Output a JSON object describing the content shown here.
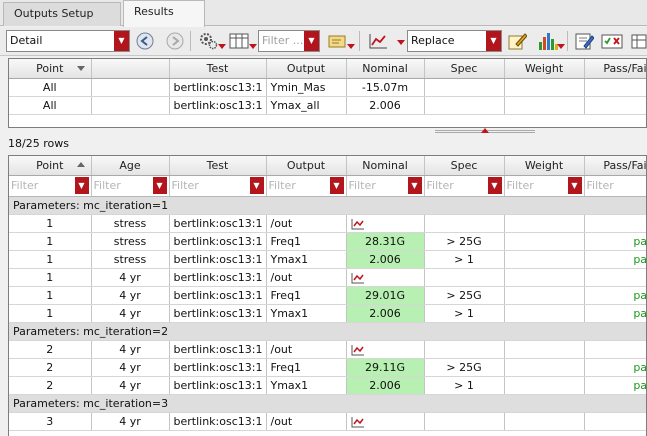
{
  "tabs": [
    {
      "label": "Outputs Setup",
      "active": false
    },
    {
      "label": "Results",
      "active": true
    }
  ],
  "toolbar": {
    "view_select": "Detail",
    "filter_placeholder": "Filter ...",
    "plot_mode": "Replace"
  },
  "colors": {
    "accent_red": "#b3151d",
    "pass_green": "#1d9a1d",
    "nominal_bg": "#b7f0b2"
  },
  "top_table": {
    "columns": [
      "Point",
      "",
      "Test",
      "Output",
      "Nominal",
      "Spec",
      "Weight",
      "Pass/Fail"
    ],
    "rows": [
      {
        "point": "All",
        "test": "bertlink:osc13:1",
        "output": "Ymin_Mas",
        "nominal": "-15.07m"
      },
      {
        "point": "All",
        "test": "bertlink:osc13:1",
        "output": "Ymax_all",
        "nominal": "2.006"
      }
    ]
  },
  "row_count": "18/25 rows",
  "main_table": {
    "columns": [
      "Point",
      "Age",
      "Test",
      "Output",
      "Nominal",
      "Spec",
      "Weight",
      "Pass/Fail"
    ],
    "filter_placeholder": "Filter",
    "groups": [
      {
        "label": "Parameters: mc_iteration=1",
        "rows": [
          {
            "point": "1",
            "age": "stress",
            "test": "bertlink:osc13:1",
            "output": "/out",
            "nominal": "",
            "wave": true,
            "spec": "",
            "pass": ""
          },
          {
            "point": "1",
            "age": "stress",
            "test": "bertlink:osc13:1",
            "output": "Freq1",
            "nominal": "28.31G",
            "wave": false,
            "spec": "> 25G",
            "pass": "pass"
          },
          {
            "point": "1",
            "age": "stress",
            "test": "bertlink:osc13:1",
            "output": "Ymax1",
            "nominal": "2.006",
            "wave": false,
            "spec": "> 1",
            "pass": "pass"
          },
          {
            "point": "1",
            "age": "4 yr",
            "test": "bertlink:osc13:1",
            "output": "/out",
            "nominal": "",
            "wave": true,
            "spec": "",
            "pass": ""
          },
          {
            "point": "1",
            "age": "4 yr",
            "test": "bertlink:osc13:1",
            "output": "Freq1",
            "nominal": "29.01G",
            "wave": false,
            "spec": "> 25G",
            "pass": "pass"
          },
          {
            "point": "1",
            "age": "4 yr",
            "test": "bertlink:osc13:1",
            "output": "Ymax1",
            "nominal": "2.006",
            "wave": false,
            "spec": "> 1",
            "pass": "pass"
          }
        ]
      },
      {
        "label": "Parameters: mc_iteration=2",
        "rows": [
          {
            "point": "2",
            "age": "4 yr",
            "test": "bertlink:osc13:1",
            "output": "/out",
            "nominal": "",
            "wave": true,
            "spec": "",
            "pass": ""
          },
          {
            "point": "2",
            "age": "4 yr",
            "test": "bertlink:osc13:1",
            "output": "Freq1",
            "nominal": "29.11G",
            "wave": false,
            "spec": "> 25G",
            "pass": "pass"
          },
          {
            "point": "2",
            "age": "4 yr",
            "test": "bertlink:osc13:1",
            "output": "Ymax1",
            "nominal": "2.006",
            "wave": false,
            "spec": "> 1",
            "pass": "pass"
          }
        ]
      },
      {
        "label": "Parameters: mc_iteration=3",
        "rows": [
          {
            "point": "3",
            "age": "4 yr",
            "test": "bertlink:osc13:1",
            "output": "/out",
            "nominal": "",
            "wave": true,
            "spec": "",
            "pass": ""
          }
        ]
      }
    ]
  }
}
